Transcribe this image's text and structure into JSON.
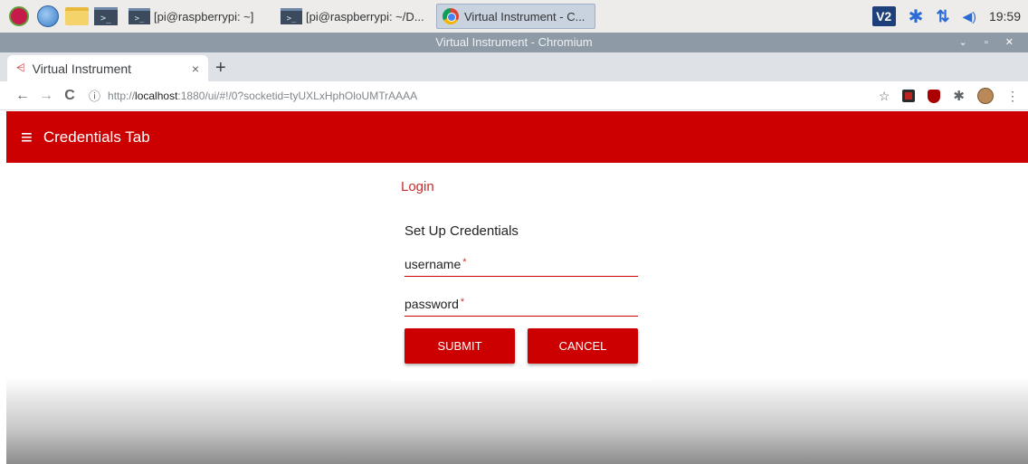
{
  "taskbar": {
    "icons": [
      "raspberry-icon",
      "globe-icon",
      "folder-icon",
      "terminal-icon"
    ],
    "tasks": [
      {
        "label": "[pi@raspberrypi: ~]",
        "icon": "terminal-icon"
      },
      {
        "label": "[pi@raspberrypi: ~/D...",
        "icon": "terminal-icon"
      },
      {
        "label": "Virtual Instrument - C...",
        "icon": "chromium-icon"
      }
    ],
    "tray": {
      "vnc": "V2",
      "clock": "19:59"
    }
  },
  "window": {
    "title": "Virtual Instrument - Chromium",
    "controls": "⌄ ▫ ✕"
  },
  "browser": {
    "tab": {
      "title": "Virtual Instrument",
      "close": "×"
    },
    "new_tab": "+",
    "nav": {
      "back": "←",
      "forward": "→",
      "reload": "C",
      "info": "ⓘ"
    },
    "url": {
      "prefix": "http://",
      "host": "localhost",
      "rest": ":1880/ui/#!/0?socketid=tyUXLxHphOloUMTrAAAA"
    },
    "bookmark": "☆",
    "menu": "⋮"
  },
  "page": {
    "menu_icon": "≡",
    "title": "Credentials Tab",
    "card": {
      "title": "Login",
      "subtitle": "Set Up Credentials",
      "username_label": "username",
      "password_label": "password",
      "required_mark": "*",
      "submit_label": "SUBMIT",
      "cancel_label": "CANCEL"
    }
  },
  "colors": {
    "header": "#cc0000",
    "accent": "#cc0000"
  }
}
